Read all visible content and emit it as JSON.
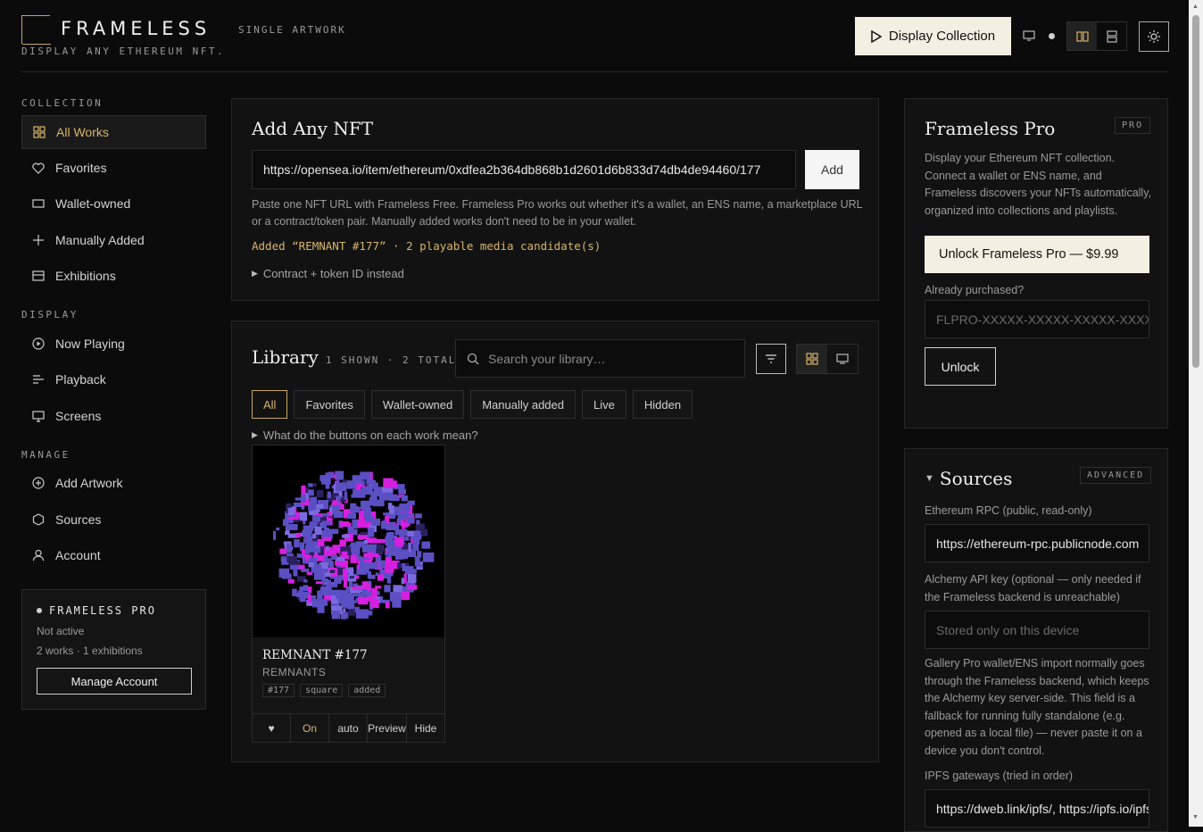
{
  "header": {
    "brand": "FRAMELESS",
    "brand_sub": "SINGLE ARTWORK",
    "tagline": "DISPLAY ANY ETHEREUM NFT.",
    "display_button": "Display Collection"
  },
  "sidebar": {
    "sections": [
      {
        "label": "COLLECTION"
      },
      {
        "label": "DISPLAY"
      },
      {
        "label": "MANAGE"
      }
    ],
    "items": [
      {
        "label": "All Works",
        "icon": "grid-icon"
      },
      {
        "label": "Favorites",
        "icon": "heart-icon"
      },
      {
        "label": "Wallet-owned",
        "icon": "wallet-icon"
      },
      {
        "label": "Manually Added",
        "icon": "plus-icon"
      },
      {
        "label": "Exhibitions",
        "icon": "exhibition-icon"
      },
      {
        "label": "Now Playing",
        "icon": "play-circle-icon"
      },
      {
        "label": "Playback",
        "icon": "playback-icon"
      },
      {
        "label": "Screens",
        "icon": "monitor-icon"
      },
      {
        "label": "Add Artwork",
        "icon": "add-circle-icon"
      },
      {
        "label": "Sources",
        "icon": "hexagon-icon"
      },
      {
        "label": "Account",
        "icon": "user-icon"
      }
    ],
    "pro_card": {
      "title": "FRAMELESS PRO",
      "status": "Not active",
      "stats": "2 works · 1 exhibitions",
      "button": "Manage Account"
    }
  },
  "add_nft": {
    "title": "Add Any NFT",
    "url_value": "https://opensea.io/item/ethereum/0xdfea2b364db868b1d2601d6b833d74db4de94460/177",
    "add_button": "Add",
    "help": "Paste one NFT URL with Frameless Free. Frameless Pro works out whether it's a wallet, an ENS name, a marketplace URL or a contract/token pair. Manually added works don't need to be in your wallet.",
    "added_status": "Added “REMNANT #177” · 2 playable media candidate(s)",
    "details_toggle": "Contract + token ID instead"
  },
  "library": {
    "title": "Library",
    "meta": "1 SHOWN · 2 TOTAL",
    "search_placeholder": "Search your library…",
    "chips": [
      "All",
      "Favorites",
      "Wallet-owned",
      "Manually added",
      "Live",
      "Hidden"
    ],
    "explain_toggle": "What do the buttons on each work mean?",
    "works": [
      {
        "title": "REMNANT #177",
        "collection": "REMNANTS",
        "tags": [
          "#177",
          "square",
          "added"
        ],
        "actions": [
          "♥",
          "On",
          "auto",
          "Preview",
          "Hide"
        ]
      }
    ]
  },
  "pro_panel": {
    "title": "Frameless Pro",
    "badge": "PRO",
    "description": "Display your Ethereum NFT collection. Connect a wallet or ENS name, and Frameless discovers your NFTs automatically, organized into collections and playlists.",
    "unlock_cta": "Unlock Frameless Pro — $9.99",
    "purchased_label": "Already purchased?",
    "license_placeholder": "FLPRO-XXXXX-XXXXX-XXXXX-XXXXX",
    "unlock_button": "Unlock"
  },
  "sources_panel": {
    "title": "Sources",
    "badge": "ADVANCED",
    "rpc_label": "Ethereum RPC (public, read-only)",
    "rpc_value": "https://ethereum-rpc.publicnode.com",
    "alchemy_label": "Alchemy API key (optional — only needed if the Frameless backend is unreachable)",
    "alchemy_placeholder": "Stored only on this device",
    "alchemy_help": "Gallery Pro wallet/ENS import normally goes through the Frameless backend, which keeps the Alchemy key server-side. This field is a fallback for running fully standalone (e.g. opened as a local file) — never paste it on a device you don't control.",
    "ipfs_label": "IPFS gateways (tried in order)",
    "ipfs_value": "https://dweb.link/ipfs/, https://ipfs.io/ipfs/"
  },
  "colors": {
    "accent": "#d8b56a",
    "background": "#0b0b0c",
    "panel": "#121213",
    "cta": "#f4efe3"
  }
}
